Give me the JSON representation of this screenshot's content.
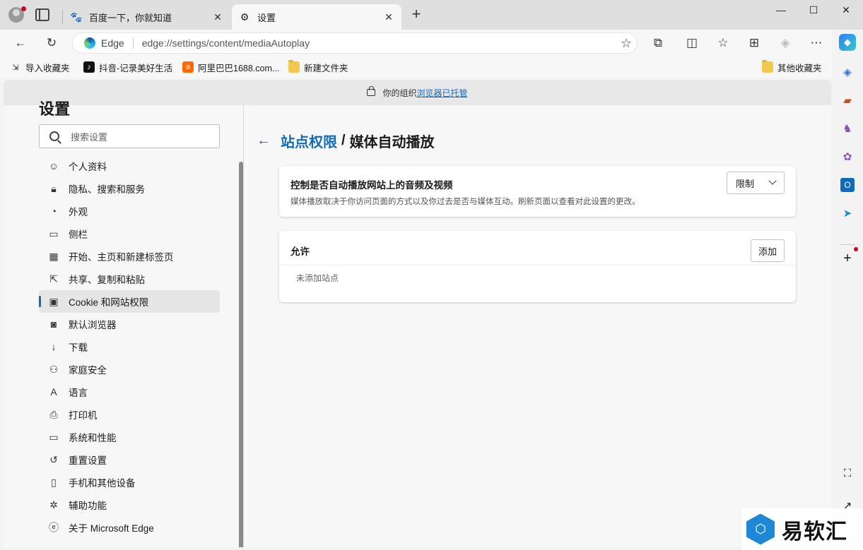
{
  "tabs": [
    {
      "title": "百度一下，你就知道",
      "active": false
    },
    {
      "title": "设置",
      "active": true
    }
  ],
  "address": {
    "label": "Edge",
    "url": "edge://settings/content/mediaAutoplay"
  },
  "bookmarks": [
    {
      "label": "导入收藏夹"
    },
    {
      "label": "抖音-记录美好生活"
    },
    {
      "label": "阿里巴巴1688.com..."
    },
    {
      "label": "新建文件夹"
    },
    {
      "label": "其他收藏夹"
    }
  ],
  "infobar": {
    "text": "你的组织",
    "link": "浏览器已托管"
  },
  "settings": {
    "heading": "设置",
    "search_placeholder": "搜索设置",
    "nav": [
      {
        "label": "个人资料",
        "icon": "profile-icon"
      },
      {
        "label": "隐私、搜索和服务",
        "icon": "lock-icon"
      },
      {
        "label": "外观",
        "icon": "palette-icon"
      },
      {
        "label": "侧栏",
        "icon": "sidebar-icon"
      },
      {
        "label": "开始、主页和新建标签页",
        "icon": "home-icon"
      },
      {
        "label": "共享、复制和粘贴",
        "icon": "share-icon"
      },
      {
        "label": "Cookie 和网站权限",
        "icon": "cookie-icon",
        "selected": true
      },
      {
        "label": "默认浏览器",
        "icon": "browser-icon"
      },
      {
        "label": "下载",
        "icon": "download-icon"
      },
      {
        "label": "家庭安全",
        "icon": "family-icon"
      },
      {
        "label": "语言",
        "icon": "language-icon"
      },
      {
        "label": "打印机",
        "icon": "printer-icon"
      },
      {
        "label": "系统和性能",
        "icon": "laptop-icon"
      },
      {
        "label": "重置设置",
        "icon": "reset-icon"
      },
      {
        "label": "手机和其他设备",
        "icon": "phone-icon"
      },
      {
        "label": "辅助功能",
        "icon": "accessibility-icon"
      },
      {
        "label": "关于 Microsoft Edge",
        "icon": "edge-icon"
      }
    ]
  },
  "main": {
    "breadcrumb_parent": "站点权限",
    "breadcrumb_sep": "/",
    "breadcrumb_current": "媒体自动播放",
    "control_title": "控制是否自动播放网站上的音频及视频",
    "control_desc": "媒体播放取决于你访问页面的方式以及你过去是否与媒体互动。刷新页面以查看对此设置的更改。",
    "control_value": "限制",
    "allow_title": "允许",
    "add_label": "添加",
    "allow_empty": "未添加站点"
  },
  "watermark": {
    "text": "易软汇"
  },
  "colors": {
    "accent": "#0f6cbd",
    "selected_bg": "#e5e5e5"
  }
}
